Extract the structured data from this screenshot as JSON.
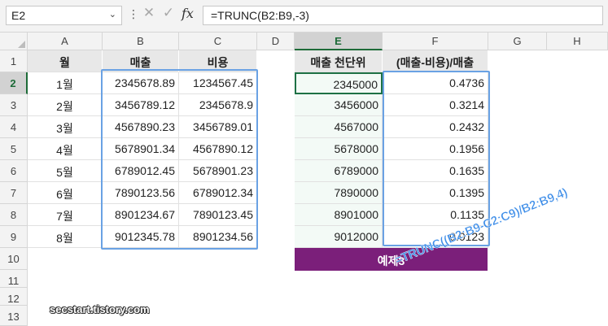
{
  "formula_bar": {
    "name_box": "E2",
    "name_box_chevron": "⌄",
    "more_icon": "⋮",
    "cancel_icon": "✕",
    "enter_icon": "✓",
    "fx_label": "fx",
    "formula": "=TRUNC(B2:B9,-3)"
  },
  "columns": [
    "A",
    "B",
    "C",
    "D",
    "E",
    "F",
    "G",
    "H"
  ],
  "rows": [
    "1",
    "2",
    "3",
    "4",
    "5",
    "6",
    "7",
    "8",
    "9",
    "10",
    "11",
    "12",
    "13"
  ],
  "table_left": {
    "headers": [
      "월",
      "매출",
      "비용"
    ],
    "rows": [
      {
        "month": "1월",
        "sales": "2345678.89",
        "cost": "1234567.45"
      },
      {
        "month": "2월",
        "sales": "3456789.12",
        "cost": "2345678.9"
      },
      {
        "month": "3월",
        "sales": "4567890.23",
        "cost": "3456789.01"
      },
      {
        "month": "4월",
        "sales": "5678901.34",
        "cost": "4567890.12"
      },
      {
        "month": "5월",
        "sales": "6789012.45",
        "cost": "5678901.23"
      },
      {
        "month": "6월",
        "sales": "7890123.56",
        "cost": "6789012.34"
      },
      {
        "month": "7월",
        "sales": "8901234.67",
        "cost": "7890123.45"
      },
      {
        "month": "8월",
        "sales": "9012345.78",
        "cost": "8901234.56"
      }
    ]
  },
  "table_right": {
    "headers": [
      "매출 천단위",
      "(매출-비용)/매출"
    ],
    "rows": [
      {
        "thousands": "2345000",
        "ratio": "0.4736"
      },
      {
        "thousands": "3456000",
        "ratio": "0.3214"
      },
      {
        "thousands": "4567000",
        "ratio": "0.2432"
      },
      {
        "thousands": "5678000",
        "ratio": "0.1956"
      },
      {
        "thousands": "6789000",
        "ratio": "0.1635"
      },
      {
        "thousands": "7890000",
        "ratio": "0.1395"
      },
      {
        "thousands": "8901000",
        "ratio": "0.1135"
      },
      {
        "thousands": "9012000",
        "ratio": "0.0123"
      }
    ]
  },
  "example_label": "예제3",
  "annotation_formula": "=TRUNC((B2:B9-C2:C9)/B2:B9,4)",
  "watermark": "secstart.tistory.com",
  "colors": {
    "header_fill": "#e8e8e8",
    "result_fill": "#f3faf6",
    "banner_fill": "#7b1f7a",
    "highlight_box": "#6aa2e4",
    "active_cell": "#1e7145"
  }
}
